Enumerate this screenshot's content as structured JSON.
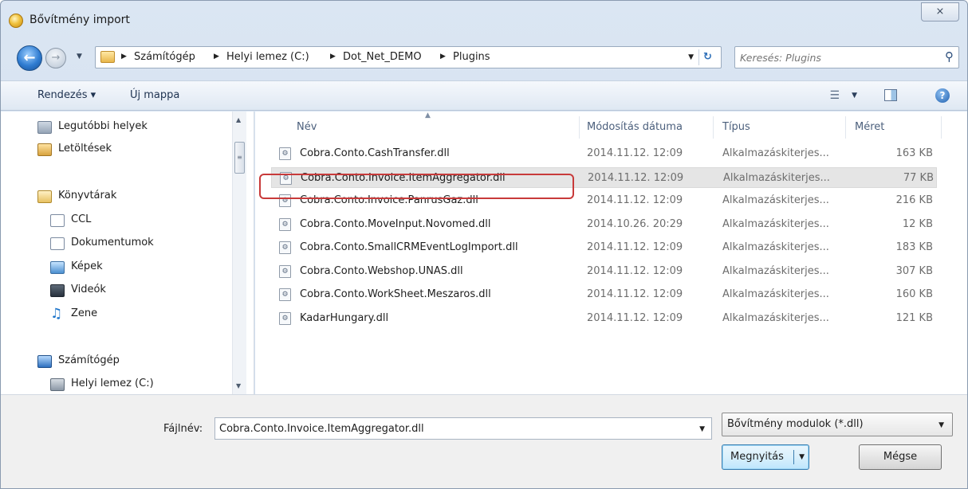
{
  "window": {
    "title": "Bővítmény import",
    "close_label": "⨯"
  },
  "address": {
    "breadcrumbs": [
      "Számítógép",
      "Helyi lemez (C:)",
      "Dot_Net_DEMO",
      "Plugins"
    ],
    "search_placeholder": "Keresés: Plugins"
  },
  "toolbar": {
    "organize_label": "Rendezés ▾",
    "new_folder_label": "Új mappa"
  },
  "nav": {
    "favorites": [
      {
        "label": "Legutóbbi helyek",
        "icon": "recent-places-icon"
      },
      {
        "label": "Letöltések",
        "icon": "downloads-icon"
      }
    ],
    "libraries": {
      "label": "Könyvtárak",
      "items": [
        {
          "label": "CCL",
          "icon": "library-icon"
        },
        {
          "label": "Dokumentumok",
          "icon": "documents-icon"
        },
        {
          "label": "Képek",
          "icon": "pictures-icon"
        },
        {
          "label": "Videók",
          "icon": "videos-icon"
        },
        {
          "label": "Zene",
          "icon": "music-icon"
        }
      ]
    },
    "computer": {
      "label": "Számítógép",
      "items": [
        {
          "label": "Helyi lemez (C:)",
          "icon": "drive-icon"
        }
      ]
    }
  },
  "files": {
    "columns": {
      "name": "Név",
      "date": "Módosítás dátuma",
      "type": "Típus",
      "size": "Méret"
    },
    "rows": [
      {
        "name": "Cobra.Conto.CashTransfer.dll",
        "date": "2014.11.12. 12:09",
        "type": "Alkalmazáskiterjes...",
        "size": "163 KB"
      },
      {
        "name": "Cobra.Conto.Invoice.ItemAggregator.dll",
        "date": "2014.11.12. 12:09",
        "type": "Alkalmazáskiterjes...",
        "size": "77 KB"
      },
      {
        "name": "Cobra.Conto.Invoice.PanrusGaz.dll",
        "date": "2014.11.12. 12:09",
        "type": "Alkalmazáskiterjes...",
        "size": "216 KB"
      },
      {
        "name": "Cobra.Conto.MoveInput.Novomed.dll",
        "date": "2014.10.26. 20:29",
        "type": "Alkalmazáskiterjes...",
        "size": "12 KB"
      },
      {
        "name": "Cobra.Conto.SmallCRMEventLogImport.dll",
        "date": "2014.11.12. 12:09",
        "type": "Alkalmazáskiterjes...",
        "size": "183 KB"
      },
      {
        "name": "Cobra.Conto.Webshop.UNAS.dll",
        "date": "2014.11.12. 12:09",
        "type": "Alkalmazáskiterjes...",
        "size": "307 KB"
      },
      {
        "name": "Cobra.Conto.WorkSheet.Meszaros.dll",
        "date": "2014.11.12. 12:09",
        "type": "Alkalmazáskiterjes...",
        "size": "160 KB"
      },
      {
        "name": "KadarHungary.dll",
        "date": "2014.11.12. 12:09",
        "type": "Alkalmazáskiterjes...",
        "size": "121 KB"
      }
    ],
    "selected_index": 1
  },
  "bottom": {
    "filename_label": "Fájlnév:",
    "filename_value": "Cobra.Conto.Invoice.ItemAggregator.dll",
    "filetype_value": "Bővítmény modulok (*.dll)",
    "open_label": "Megnyitás",
    "cancel_label": "Mégse"
  },
  "colors": {
    "highlight_border": "#c83a3a",
    "selected_row": "#e5e5e5"
  }
}
